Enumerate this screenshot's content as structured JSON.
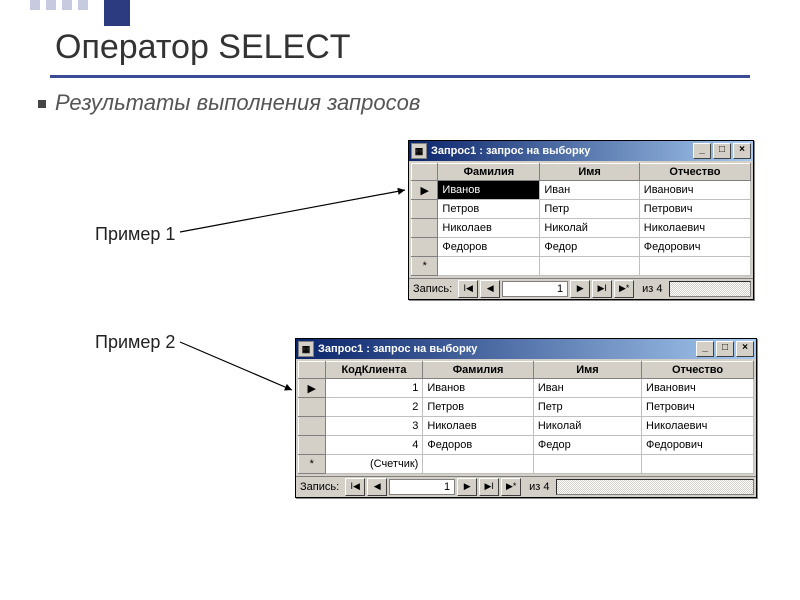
{
  "slide": {
    "title": "Оператор SELECT",
    "subtitle": "Результаты выполнения запросов",
    "example1_label": "Пример 1",
    "example2_label": "Пример 2"
  },
  "win1": {
    "title": "Запрос1 : запрос на выборку",
    "icon_glyph": "▦",
    "minimize": "_",
    "maximize": "□",
    "close": "×",
    "columns": [
      "Фамилия",
      "Имя",
      "Отчество"
    ],
    "rows": [
      {
        "marker": "▶",
        "cells": [
          "Иванов",
          "Иван",
          "Иванович"
        ],
        "selected_first": true
      },
      {
        "marker": "",
        "cells": [
          "Петров",
          "Петр",
          "Петрович"
        ]
      },
      {
        "marker": "",
        "cells": [
          "Николаев",
          "Николай",
          "Николаевич"
        ]
      },
      {
        "marker": "",
        "cells": [
          "Федоров",
          "Федор",
          "Федорович"
        ]
      },
      {
        "marker": "*",
        "cells": [
          "",
          "",
          ""
        ]
      }
    ],
    "nav": {
      "label": "Запись:",
      "current": "1",
      "count": "из  4",
      "first": "I◀",
      "prev": "◀",
      "next": "▶",
      "last": "▶I",
      "new": "▶*"
    }
  },
  "win2": {
    "title": "Запрос1 : запрос на выборку",
    "icon_glyph": "▦",
    "minimize": "_",
    "maximize": "□",
    "close": "×",
    "columns": [
      "КодКлиента",
      "Фамилия",
      "Имя",
      "Отчество"
    ],
    "rows": [
      {
        "marker": "▶",
        "cells": [
          "1",
          "Иванов",
          "Иван",
          "Иванович"
        ]
      },
      {
        "marker": "",
        "cells": [
          "2",
          "Петров",
          "Петр",
          "Петрович"
        ]
      },
      {
        "marker": "",
        "cells": [
          "3",
          "Николаев",
          "Николай",
          "Николаевич"
        ]
      },
      {
        "marker": "",
        "cells": [
          "4",
          "Федоров",
          "Федор",
          "Федорович"
        ]
      },
      {
        "marker": "*",
        "cells": [
          "(Счетчик)",
          "",
          "",
          ""
        ]
      }
    ],
    "nav": {
      "label": "Запись:",
      "current": "1",
      "count": "из  4",
      "first": "I◀",
      "prev": "◀",
      "next": "▶",
      "last": "▶I",
      "new": "▶*"
    }
  }
}
